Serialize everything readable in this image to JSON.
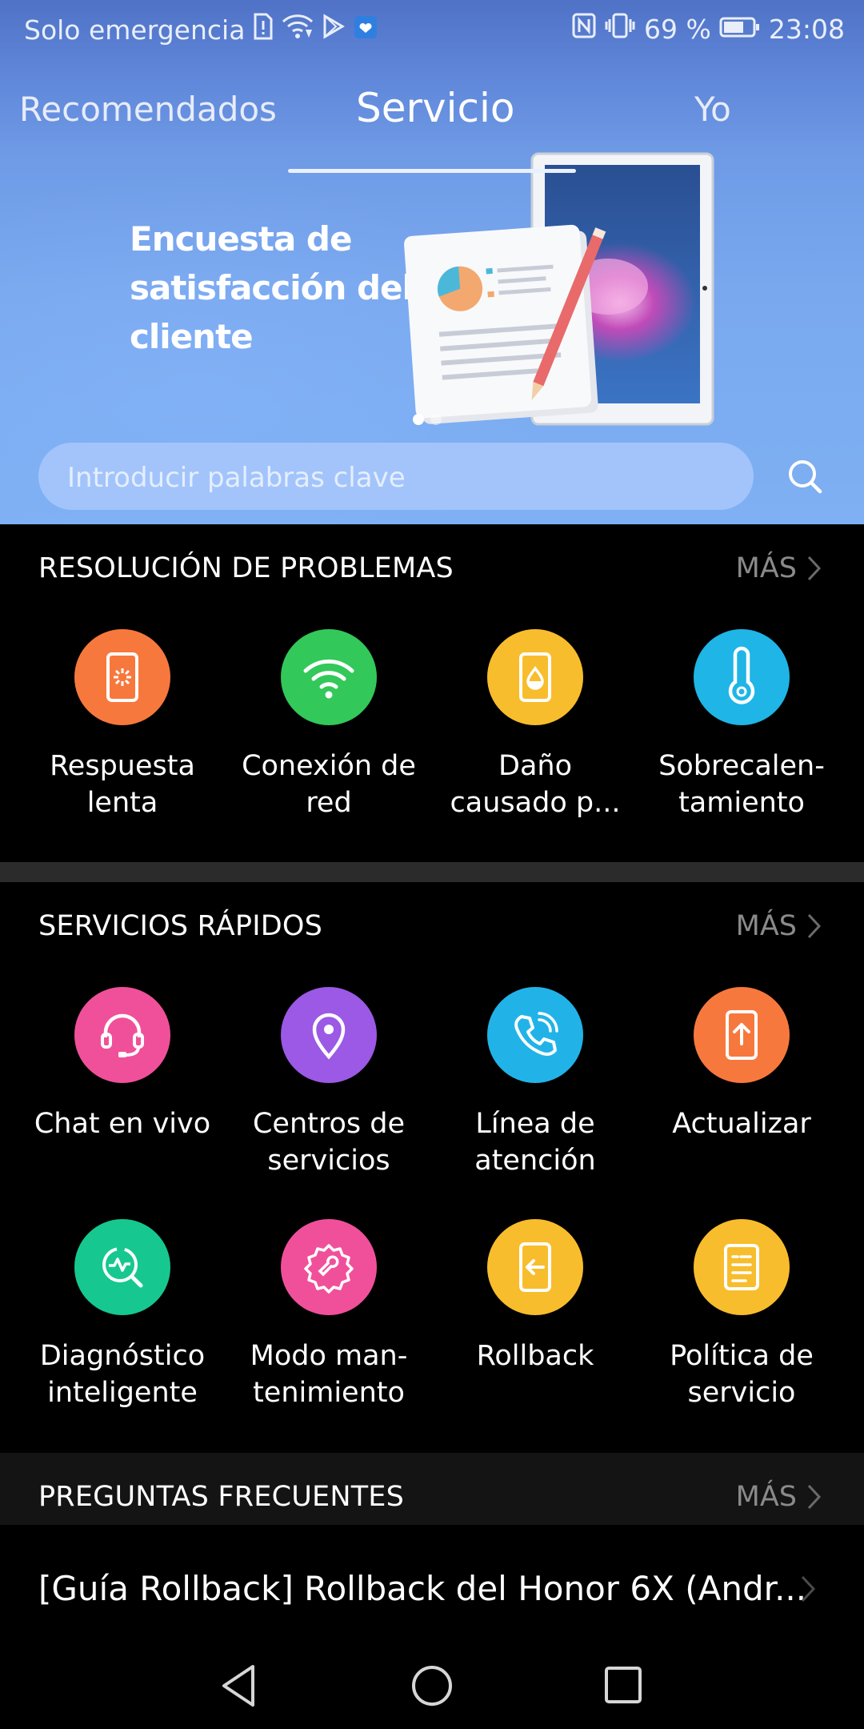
{
  "status_bar": {
    "carrier": "Solo emergencia",
    "battery": "69 %",
    "time": "23:08"
  },
  "tabs": [
    {
      "label": "Recomendados"
    },
    {
      "label": "Servicio"
    },
    {
      "label": "Yo"
    }
  ],
  "banner": {
    "title": "Encuesta de satisfacción del cliente"
  },
  "search": {
    "placeholder": "Introducir palabras clave"
  },
  "troubleshooting": {
    "title": "RESOLUCIÓN DE PROBLEMAS",
    "more": "MÁS",
    "items": [
      {
        "label": "Respuesta lenta",
        "icon": "slow-response-phone-icon",
        "color": "#f7783d"
      },
      {
        "label": "Conexión de red",
        "icon": "wifi-icon",
        "color": "#33c85a"
      },
      {
        "label": "Daño causado p...",
        "icon": "water-damage-phone-icon",
        "color": "#f8bd2c"
      },
      {
        "label": "Sobrecalen-tamiento",
        "icon": "thermometer-icon",
        "color": "#1fb5e6"
      }
    ]
  },
  "quick_services": {
    "title": "SERVICIOS RÁPIDOS",
    "more": "MÁS",
    "items": [
      {
        "label": "Chat en vivo",
        "icon": "headset-icon",
        "color": "#f0509a"
      },
      {
        "label": "Centros de servicios",
        "icon": "location-pin-icon",
        "color": "#9b59e5"
      },
      {
        "label": "Línea de atención",
        "icon": "phone-call-icon",
        "color": "#21b3e8"
      },
      {
        "label": "Actualizar",
        "icon": "update-phone-icon",
        "color": "#f7783d"
      },
      {
        "label": "Diagnóstico inteligente",
        "icon": "diagnostic-icon",
        "color": "#16c88f"
      },
      {
        "label": "Modo man-tenimiento",
        "icon": "maintenance-gear-icon",
        "color": "#f0509a"
      },
      {
        "label": "Rollback",
        "icon": "rollback-phone-icon",
        "color": "#f8bd2c"
      },
      {
        "label": "Política de servicio",
        "icon": "policy-document-icon",
        "color": "#f8bd2c"
      }
    ]
  },
  "faq": {
    "title": "PREGUNTAS FRECUENTES",
    "more": "MÁS",
    "items": [
      {
        "label": "[Guía Rollback] Rollback del Honor 6X (Andr..."
      }
    ]
  }
}
